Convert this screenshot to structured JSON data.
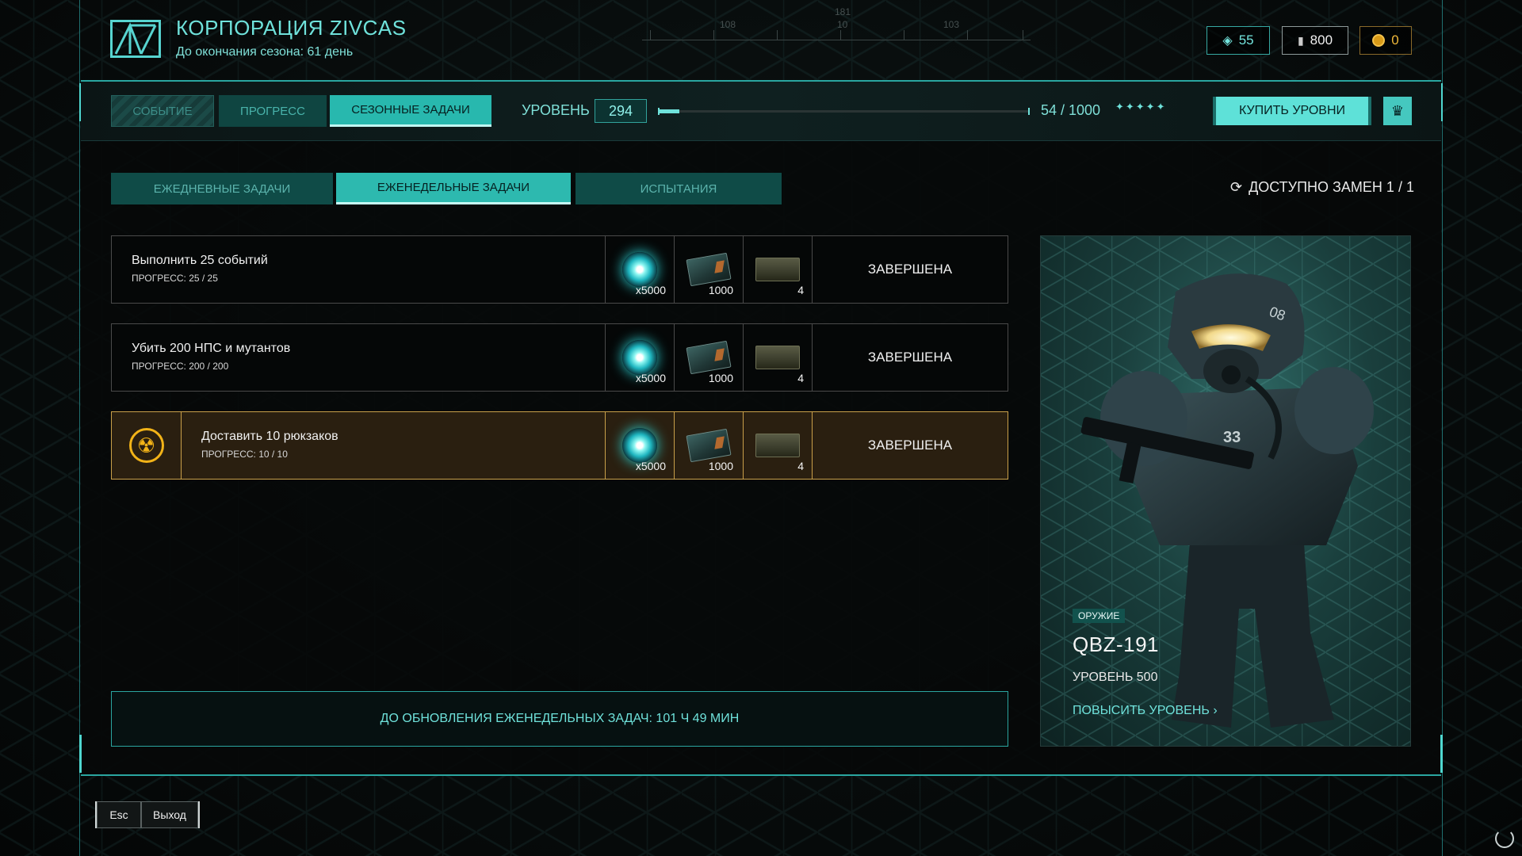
{
  "header": {
    "corp_title": "КОРПОРАЦИЯ ZIVCAS",
    "season_remaining": "До окончания сезона: 61 день",
    "compass_numbers": [
      "108",
      "181",
      "10",
      "103"
    ]
  },
  "currencies": {
    "tokens": "55",
    "silver": "800",
    "gold": "0"
  },
  "main_tabs": [
    {
      "label": "СОБЫТИЕ",
      "state": "disabled"
    },
    {
      "label": "ПРОГРЕСС",
      "state": "inactive"
    },
    {
      "label": "СЕЗОННЫЕ ЗАДАЧИ",
      "state": "active"
    }
  ],
  "level": {
    "label": "УРОВЕНЬ",
    "value": "294",
    "progress_text": "54 / 1000",
    "progress_fraction": 0.054,
    "stars": "✦✦✦✦✦"
  },
  "buy_levels_label": "КУПИТЬ УРОВНИ",
  "sub_tabs": [
    {
      "label": "ЕЖЕДНЕВНЫЕ ЗАДАЧИ",
      "state": "inactive"
    },
    {
      "label": "ЕЖЕНЕДЕЛЬНЫЕ ЗАДАЧИ",
      "state": "active"
    },
    {
      "label": "ИСПЫТАНИЯ",
      "state": "inactive"
    }
  ],
  "replacements_label": "ДОСТУПНО ЗАМЕН 1 / 1",
  "tasks": [
    {
      "name": "Выполнить 25 событий",
      "progress": "ПРОГРЕСС: 25 / 25",
      "rewards": {
        "orb_qty": "x5000",
        "voucher_qty": "1000",
        "crate_qty": "4"
      },
      "status": "ЗАВЕРШЕНА"
    },
    {
      "name": "Убить 200 НПС и мутантов",
      "progress": "ПРОГРЕСС: 200 / 200",
      "rewards": {
        "orb_qty": "x5000",
        "voucher_qty": "1000",
        "crate_qty": "4"
      },
      "status": "ЗАВЕРШЕНА"
    },
    {
      "name": "Доставить 10 рюкзаков",
      "progress": "ПРОГРЕСС: 10 / 10",
      "rewards": {
        "orb_qty": "x5000",
        "voucher_qty": "1000",
        "crate_qty": "4"
      },
      "status": "ЗАВЕРШЕНА"
    }
  ],
  "weekly_timer": "ДО ОБНОВЛЕНИЯ ЕЖЕНЕДЕЛЬНЫХ ЗАДАЧ: 101 ч 49 мин",
  "reward_card": {
    "tag": "ОРУЖИЕ",
    "title": "QBZ-191",
    "level": "УРОВЕНЬ 500",
    "upgrade_link": "ПОВЫСИТЬ УРОВЕНЬ",
    "helmet_number": "08",
    "chest_number": "33"
  },
  "footer": {
    "esc_key": "Esc",
    "exit_label": "Выход"
  },
  "colors": {
    "accent": "#6fe2db",
    "active_tab": "#2db9af",
    "highlight_border": "#caa04a",
    "highlight_bg": "#2a1f10"
  }
}
